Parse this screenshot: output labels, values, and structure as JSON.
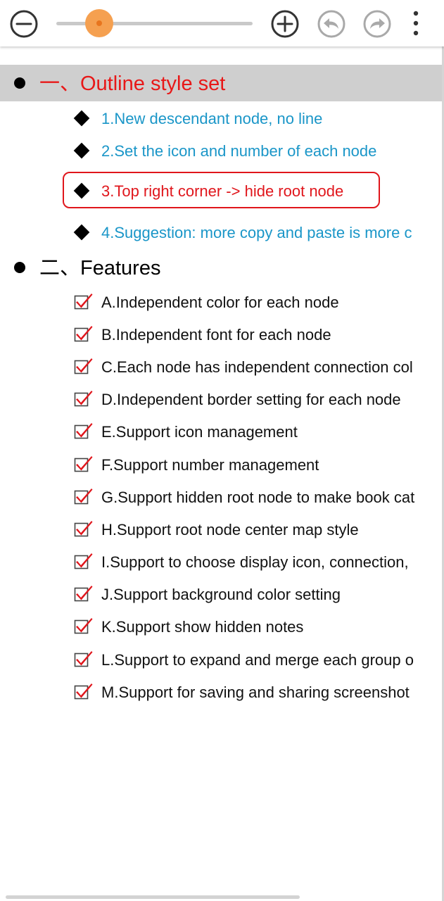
{
  "toolbar": {
    "zoom_level_fraction": 0.22,
    "thumb_color": "#f5a050",
    "buttons": [
      {
        "name": "zoom-out-button",
        "icon": "minus-circle-icon"
      },
      {
        "name": "zoom-in-button",
        "icon": "plus-circle-icon"
      },
      {
        "name": "undo-button",
        "icon": "undo-arrow-icon"
      },
      {
        "name": "redo-button",
        "icon": "redo-arrow-icon"
      },
      {
        "name": "more-options-button",
        "icon": "more-vertical-icon"
      }
    ]
  },
  "outline": {
    "sections": [
      {
        "title": "一、Outline style set",
        "title_color": "#e81818",
        "highlighted": true,
        "item_icon": "diamond-icon",
        "items": [
          {
            "label": "1.New descendant node, no line",
            "color": "#1a96c8"
          },
          {
            "label": "2.Set the icon and number of each node",
            "color": "#1a96c8"
          },
          {
            "label": "3.Top right corner -> hide root node",
            "color": "#e0161c",
            "boxed": true
          },
          {
            "label": "4.Suggestion: more copy and paste is more c",
            "color": "#1a96c8"
          }
        ]
      },
      {
        "title": "二、Features",
        "title_color": "#000000",
        "highlighted": false,
        "item_icon": "checkbox-checked-icon",
        "items": [
          {
            "label": "A.Independent color for each node",
            "color": "#111111"
          },
          {
            "label": "B.Independent font for each node",
            "color": "#111111"
          },
          {
            "label": "C.Each node has independent connection col",
            "color": "#111111"
          },
          {
            "label": "D.Independent border setting for each node",
            "color": "#111111"
          },
          {
            "label": "E.Support icon management",
            "color": "#111111"
          },
          {
            "label": "F.Support number management",
            "color": "#111111"
          },
          {
            "label": "G.Support hidden root node to make book cat",
            "color": "#111111"
          },
          {
            "label": "H.Support root node center map style",
            "color": "#111111"
          },
          {
            "label": "I.Support to choose display icon, connection,",
            "color": "#111111"
          },
          {
            "label": "J.Support background color setting",
            "color": "#111111"
          },
          {
            "label": "K.Support show hidden notes",
            "color": "#111111"
          },
          {
            "label": "L.Support to expand and merge each group o",
            "color": "#111111"
          },
          {
            "label": "M.Support for saving and sharing screenshot",
            "color": "#111111"
          }
        ]
      }
    ]
  }
}
